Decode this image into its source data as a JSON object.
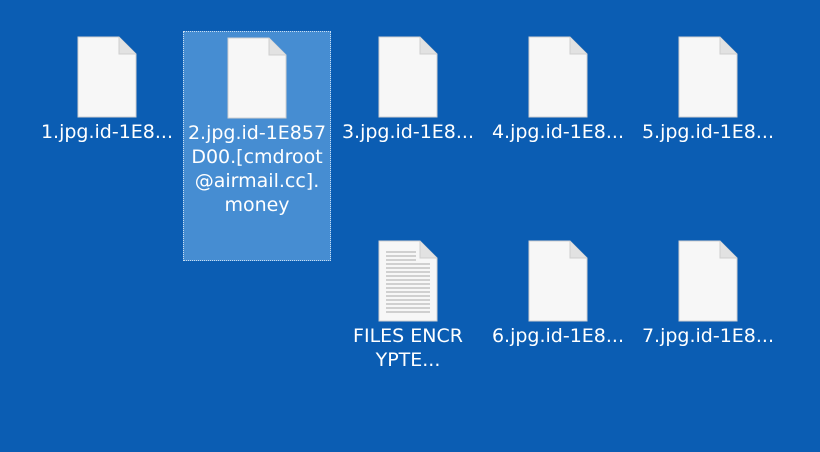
{
  "desktop": {
    "files": [
      {
        "label": "1.jpg.id-1E8..."
      },
      {
        "label": "2.jpg.id-1E857D00.[cmdroot@airmail.cc].money"
      },
      {
        "label": "3.jpg.id-1E8..."
      },
      {
        "label": "4.jpg.id-1E8..."
      },
      {
        "label": "5.jpg.id-1E8..."
      },
      {
        "label": "FILES ENCRYPTE..."
      },
      {
        "label": "6.jpg.id-1E8..."
      },
      {
        "label": "7.jpg.id-1E8..."
      }
    ],
    "icons": {
      "blank": "blank-file-icon",
      "text": "text-document-icon"
    },
    "colors": {
      "background": "#0b5db3",
      "selection": "#7ab4eb",
      "label": "#ffffff"
    }
  }
}
